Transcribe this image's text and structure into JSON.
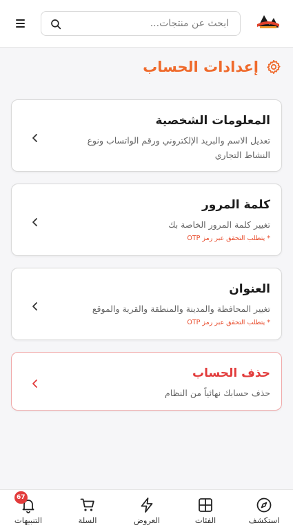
{
  "header": {
    "search_placeholder": "ابحث عن منتجات...",
    "accent": "#ef6a2c"
  },
  "page": {
    "title": "إعدادات الحساب"
  },
  "cards": [
    {
      "title": "المعلومات الشخصية",
      "description": "تعديل الاسم والبريد الإلكتروني ورقم الواتساب ونوع النشاط التجاري",
      "note": ""
    },
    {
      "title": "كلمة المرور",
      "description": "تغيير كلمة المرور الخاصة بك",
      "note": "* يتطلب التحقق عبر رمز OTP"
    },
    {
      "title": "العنوان",
      "description": "تغيير المحافظة والمدينة والمنطقة والقرية والموقع",
      "note": "* يتطلب التحقق عبر رمز OTP"
    },
    {
      "title": "حذف الحساب",
      "description": "حذف حسابك نهائياً من النظام",
      "note": ""
    }
  ],
  "bottom_nav": [
    {
      "label": "استكشف",
      "icon": "compass-icon"
    },
    {
      "label": "الفئات",
      "icon": "grid-icon"
    },
    {
      "label": "العروض",
      "icon": "bolt-icon"
    },
    {
      "label": "السلة",
      "icon": "cart-icon"
    },
    {
      "label": "التنبيهات",
      "icon": "bell-icon",
      "badge": "67"
    }
  ],
  "colors": {
    "danger": "#e23b3b",
    "danger_border": "#f0a8a8"
  }
}
